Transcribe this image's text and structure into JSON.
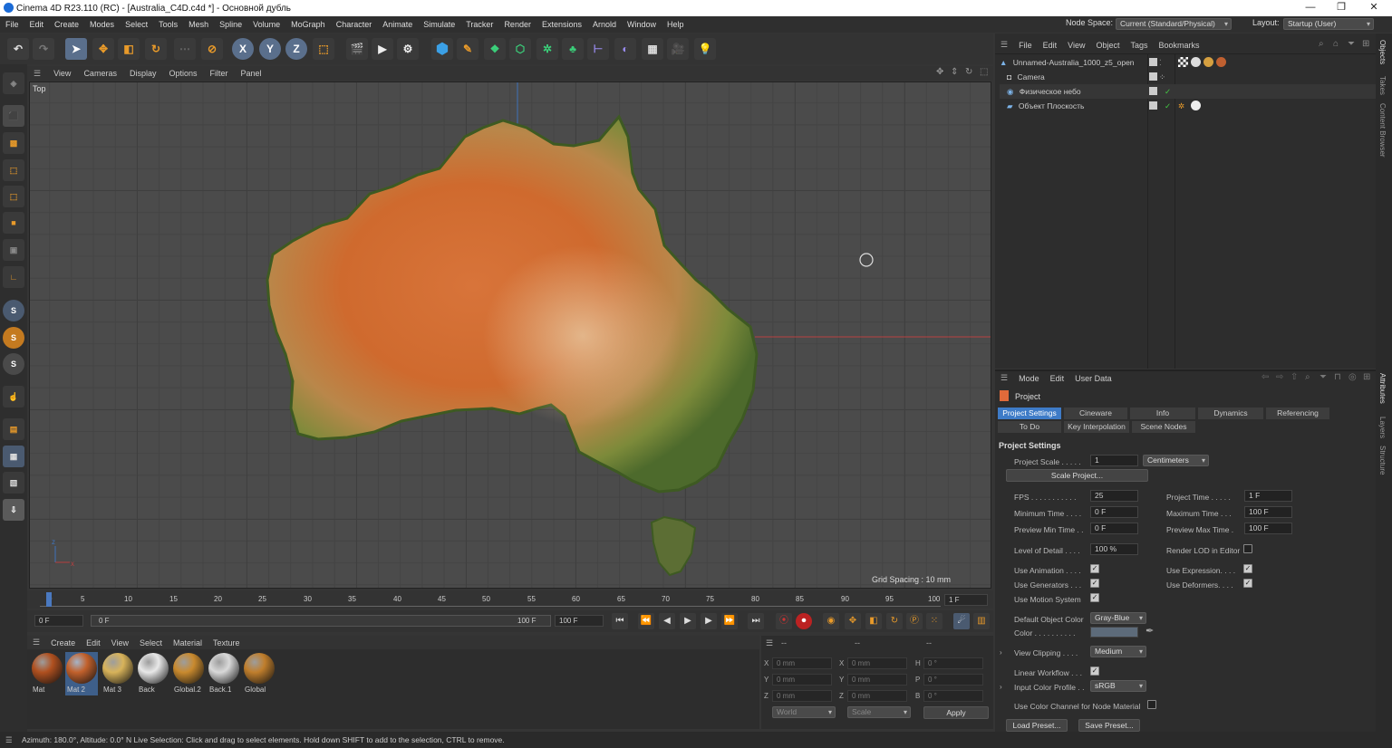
{
  "window": {
    "title": "Cinema 4D R23.110 (RC) - [Australia_C4D.c4d *] - Основной дубль",
    "controls": [
      "—",
      "❐",
      "✕"
    ]
  },
  "menubar": {
    "items": [
      "File",
      "Edit",
      "Create",
      "Modes",
      "Select",
      "Tools",
      "Mesh",
      "Spline",
      "Volume",
      "MoGraph",
      "Character",
      "Animate",
      "Simulate",
      "Tracker",
      "Render",
      "Extensions",
      "Arnold",
      "Window",
      "Help"
    ],
    "node_space_label": "Node Space:",
    "node_space_value": "Current (Standard/Physical)",
    "layout_label": "Layout:",
    "layout_value": "Startup (User)"
  },
  "toolbar": {
    "axis_x": "X",
    "axis_y": "Y",
    "axis_z": "Z"
  },
  "viewport": {
    "menu": [
      "View",
      "Cameras",
      "Display",
      "Options",
      "Filter",
      "Panel"
    ],
    "label": "Top",
    "grid_spacing": "Grid Spacing : 10 mm"
  },
  "timeline": {
    "ticks": [
      "0",
      "5",
      "10",
      "15",
      "20",
      "25",
      "30",
      "35",
      "40",
      "45",
      "50",
      "55",
      "60",
      "65",
      "70",
      "75",
      "80",
      "85",
      "90",
      "95",
      "100"
    ],
    "current_frame": "1 F",
    "start": "0 F",
    "range_start": "0 F",
    "range_end": "100 F",
    "end": "100 F"
  },
  "materials": {
    "menu": [
      "Create",
      "Edit",
      "View",
      "Select",
      "Material",
      "Texture"
    ],
    "items": [
      {
        "name": "Mat",
        "color": "#b0501f"
      },
      {
        "name": "Mat 2",
        "color": "#c2612c"
      },
      {
        "name": "Mat 3",
        "color": "#d8b35a"
      },
      {
        "name": "Back",
        "color": "#e8e8e8"
      },
      {
        "name": "Global.2",
        "color": "#c98a2e"
      },
      {
        "name": "Back.1",
        "color": "#d9d9d9"
      },
      {
        "name": "Global",
        "color": "#c07e2c"
      }
    ],
    "selected_index": 1
  },
  "coordinates": {
    "header": "--",
    "rows": [
      {
        "l1": "X",
        "v1": "0 mm",
        "l2": "X",
        "v2": "0 mm",
        "l3": "H",
        "v3": "0 °"
      },
      {
        "l1": "Y",
        "v1": "0 mm",
        "l2": "Y",
        "v2": "0 mm",
        "l3": "P",
        "v3": "0 °"
      },
      {
        "l1": "Z",
        "v1": "0 mm",
        "l2": "Z",
        "v2": "0 mm",
        "l3": "B",
        "v3": "0 °"
      }
    ],
    "mode1": "World",
    "mode2": "Scale",
    "apply": "Apply"
  },
  "objects": {
    "menu": [
      "File",
      "Edit",
      "View",
      "Object",
      "Tags",
      "Bookmarks"
    ],
    "rows": [
      {
        "name": "Unnamed-Australia_1000_z5_open"
      },
      {
        "name": "Camera"
      },
      {
        "name": "Физическое небо"
      },
      {
        "name": "Объект Плоскость"
      }
    ]
  },
  "attributes": {
    "menu": [
      "Mode",
      "Edit",
      "User Data"
    ],
    "object_label": "Project",
    "tabs_row1": [
      "Project Settings",
      "Cineware",
      "Info",
      "Dynamics",
      "Referencing"
    ],
    "tabs_row2": [
      "To Do",
      "Key Interpolation",
      "Scene Nodes"
    ],
    "section": "Project Settings",
    "project_scale_label": "Project Scale . . . . .",
    "project_scale_value": "1",
    "project_scale_unit": "Centimeters",
    "scale_project_btn": "Scale Project...",
    "fps_label": "FPS . . . . . . . . . . .",
    "fps_value": "25",
    "project_time_label": "Project Time . . . . .",
    "project_time_value": "1 F",
    "min_time_label": "Minimum Time . . . .",
    "min_time_value": "0 F",
    "max_time_label": "Maximum Time . . .",
    "max_time_value": "100 F",
    "prev_min_label": "Preview Min Time . .",
    "prev_min_value": "0 F",
    "prev_max_label": "Preview Max Time .",
    "prev_max_value": "100 F",
    "lod_label": "Level of Detail . . . .",
    "lod_value": "100 %",
    "render_lod_label": "Render LOD in Editor",
    "use_anim_label": "Use Animation . . . .",
    "use_expr_label": "Use Expression. . . .",
    "use_gen_label": "Use Generators . . .",
    "use_def_label": "Use Deformers. . . .",
    "use_motion_label": "Use Motion System",
    "def_obj_color_label": "Default Object Color",
    "def_obj_color_value": "Gray-Blue",
    "color_label": "Color . . . . . . . . . .",
    "view_clipping_label": "View Clipping . . . .",
    "view_clipping_value": "Medium",
    "linear_wf_label": "Linear Workflow . . .",
    "input_profile_label": "Input Color Profile . .",
    "input_profile_value": "sRGB",
    "color_channel_label": "Use Color Channel for Node Material",
    "load_preset": "Load Preset...",
    "save_preset": "Save Preset..."
  },
  "side_tabs": [
    "Objects",
    "Takes",
    "Content Browser",
    "Attributes",
    "Layers",
    "Structure"
  ],
  "status": {
    "text": "Azimuth: 180.0°, Altitude: 0.0°  N     Live Selection: Click and drag to select elements. Hold down SHIFT to add to the selection, CTRL to remove."
  }
}
